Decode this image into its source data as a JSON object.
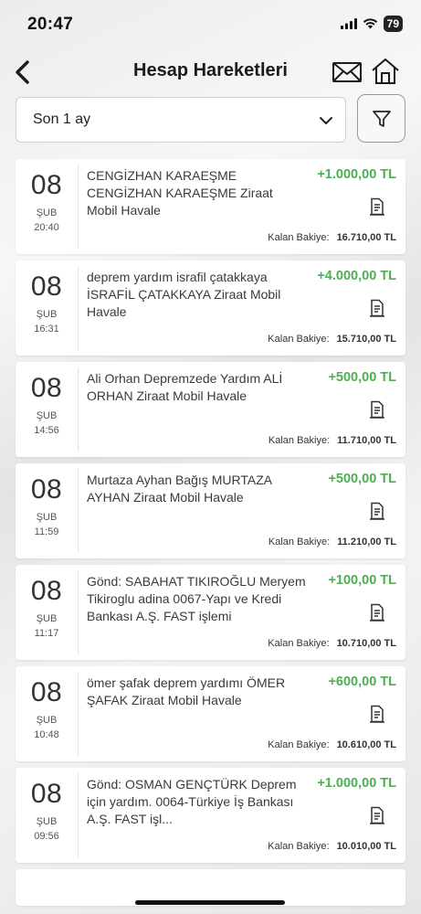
{
  "status_bar": {
    "time": "20:47",
    "battery": "79"
  },
  "header": {
    "title": "Hesap Hareketleri"
  },
  "filter": {
    "period": "Son 1 ay"
  },
  "transactions": [
    {
      "day": "08",
      "month": "ŞUB",
      "time": "20:40",
      "description": "CENGİZHAN KARAEŞME CENGİZHAN KARAEŞME Ziraat Mobil Havale",
      "amount": "+1.000,00 TL",
      "balance_label": "Kalan Bakiye:",
      "balance": "16.710,00 TL"
    },
    {
      "day": "08",
      "month": "ŞUB",
      "time": "16:31",
      "description": "deprem yardım israfil çatakkaya İSRAFİL ÇATAKKAYA Ziraat Mobil Havale",
      "amount": "+4.000,00 TL",
      "balance_label": "Kalan Bakiye:",
      "balance": "15.710,00 TL"
    },
    {
      "day": "08",
      "month": "ŞUB",
      "time": "14:56",
      "description": "Ali Orhan Depremzede Yardım ALİ ORHAN Ziraat Mobil Havale",
      "amount": "+500,00 TL",
      "balance_label": "Kalan Bakiye:",
      "balance": "11.710,00 TL"
    },
    {
      "day": "08",
      "month": "ŞUB",
      "time": "11:59",
      "description": "Murtaza Ayhan Bağış MURTAZA AYHAN Ziraat Mobil Havale",
      "amount": "+500,00 TL",
      "balance_label": "Kalan Bakiye:",
      "balance": "11.210,00 TL"
    },
    {
      "day": "08",
      "month": "ŞUB",
      "time": "11:17",
      "description": "Gönd: SABAHAT TIKIROĞLU Meryem Tikiroglu adina 0067-Yapı ve Kredi Bankası A.Ş. FAST işlemi",
      "amount": "+100,00 TL",
      "balance_label": "Kalan Bakiye:",
      "balance": "10.710,00 TL"
    },
    {
      "day": "08",
      "month": "ŞUB",
      "time": "10:48",
      "description": "ömer şafak deprem yardımı ÖMER ŞAFAK Ziraat Mobil Havale",
      "amount": "+600,00 TL",
      "balance_label": "Kalan Bakiye:",
      "balance": "10.610,00 TL"
    },
    {
      "day": "08",
      "month": "ŞUB",
      "time": "09:56",
      "description": "Gönd: OSMAN GENÇTÜRK Deprem için yardım. 0064-Türkiye İş Bankası A.Ş. FAST işl...",
      "amount": "+1.000,00 TL",
      "balance_label": "Kalan Bakiye:",
      "balance": "10.010,00 TL"
    }
  ],
  "colors": {
    "credit": "#4caf50",
    "text": "#1e1e1e"
  },
  "icons": [
    "back-arrow-icon",
    "mail-icon",
    "home-icon",
    "chevron-down-icon",
    "filter-funnel-icon",
    "receipt-icon"
  ]
}
